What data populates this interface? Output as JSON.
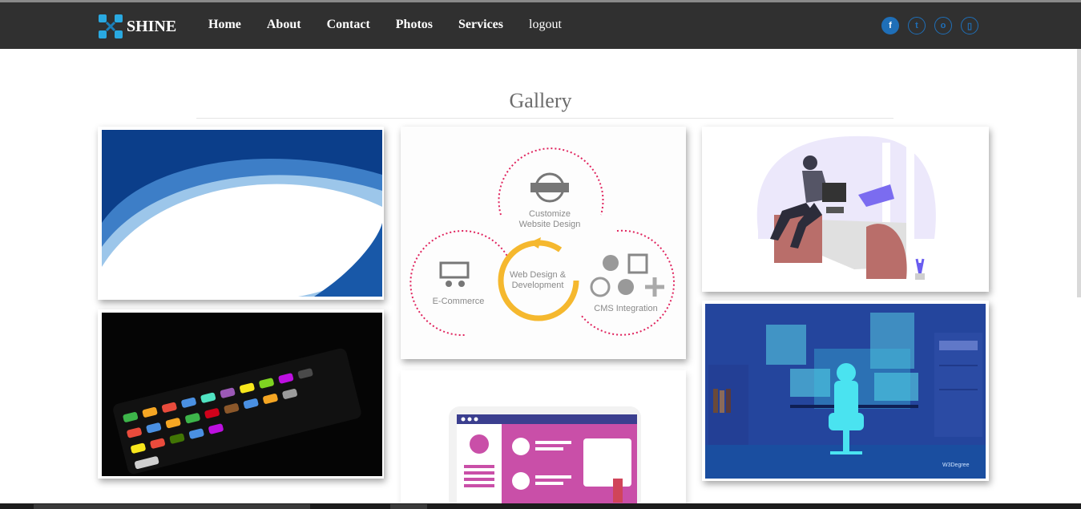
{
  "brand": {
    "name": "SHINE"
  },
  "nav": {
    "links": [
      "Home",
      "About",
      "Contact",
      "Photos",
      "Services",
      "logout"
    ]
  },
  "socials": [
    {
      "icon": "facebook-icon",
      "glyph": "f"
    },
    {
      "icon": "twitter-icon",
      "glyph": "t"
    },
    {
      "icon": "instagram-icon",
      "glyph": "o"
    },
    {
      "icon": "mobile-icon",
      "glyph": "▯"
    }
  ],
  "gallery": {
    "title": "Gallery",
    "diagram": {
      "top": "Customize\nWebsite Design",
      "center": "Web Design &\nDevelopment",
      "left": "E-Commerce",
      "right": "CMS Integration"
    },
    "watermark": "W3Degree"
  },
  "colors": {
    "navbar": "#303030",
    "accent": "#1f6fb8",
    "diagram_dotted": "#e0245e",
    "diagram_circle": "#f5b82e"
  }
}
